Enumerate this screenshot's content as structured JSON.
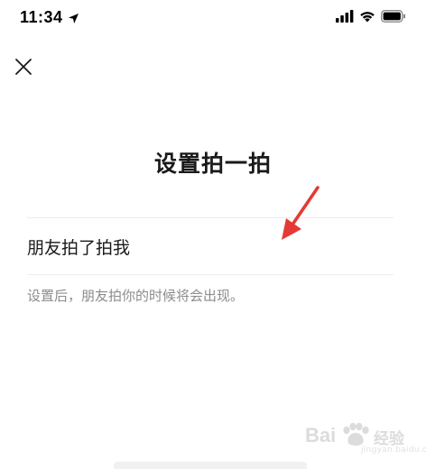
{
  "status_bar": {
    "time": "11:34",
    "icons": [
      "location-arrow-icon",
      "signal-icon",
      "wifi-icon",
      "battery-icon"
    ]
  },
  "header": {
    "close_icon": "close-icon",
    "title": "设置拍一拍"
  },
  "pat_setting": {
    "value": "朋友拍了拍我",
    "hint": "设置后，朋友拍你的时候将会出现。"
  },
  "annotation": {
    "arrow_color": "#e53935"
  },
  "watermark": {
    "logo_left": "Bai",
    "logo_right": "经验",
    "url": "jingyan.baidu.com"
  }
}
